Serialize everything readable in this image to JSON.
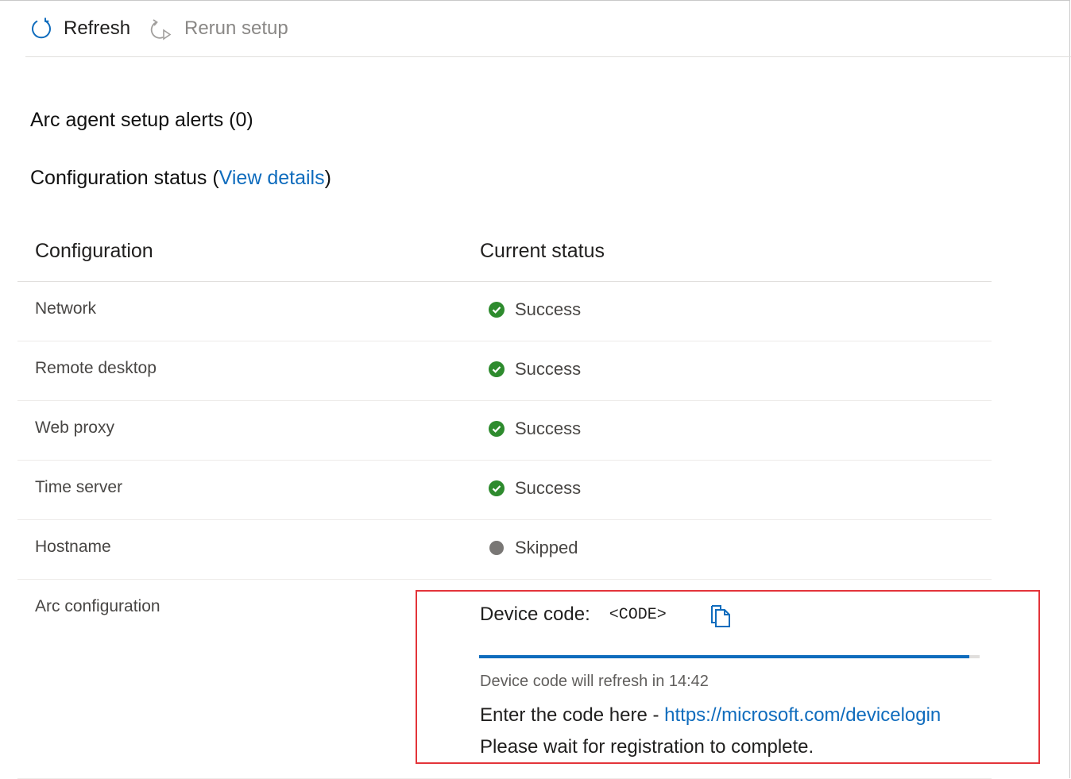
{
  "toolbar": {
    "refresh_label": "Refresh",
    "rerun_label": "Rerun setup"
  },
  "alerts": {
    "heading": "Arc agent setup alerts (0)"
  },
  "config_status": {
    "heading": "Configuration status",
    "open_paren": "(",
    "link_label": "View details",
    "close_paren": ")"
  },
  "table": {
    "headers": {
      "configuration": "Configuration",
      "current_status": "Current status"
    },
    "rows": [
      {
        "configuration": "Network",
        "status": "Success",
        "icon": "success-check-icon"
      },
      {
        "configuration": "Remote desktop",
        "status": "Success",
        "icon": "success-check-icon"
      },
      {
        "configuration": "Web proxy",
        "status": "Success",
        "icon": "success-check-icon"
      },
      {
        "configuration": "Time server",
        "status": "Success",
        "icon": "success-check-icon"
      },
      {
        "configuration": "Hostname",
        "status": "Skipped",
        "icon": "skipped-dot-icon"
      }
    ],
    "arc_row": {
      "configuration": "Arc configuration"
    }
  },
  "arc": {
    "device_code_label": "Device code:",
    "device_code_value": "<CODE>",
    "refresh_note": "Device code will refresh in 14:42",
    "enter_code_prefix": "Enter the code here - ",
    "login_url": "https://microsoft.com/devicelogin",
    "wait_note": "Please wait for registration to complete.",
    "progress_fraction": 0.98
  },
  "colors": {
    "accent": "#0f6cbd",
    "success": "#2e8b2e",
    "skipped": "#797775",
    "highlight_border": "#e3343a"
  }
}
